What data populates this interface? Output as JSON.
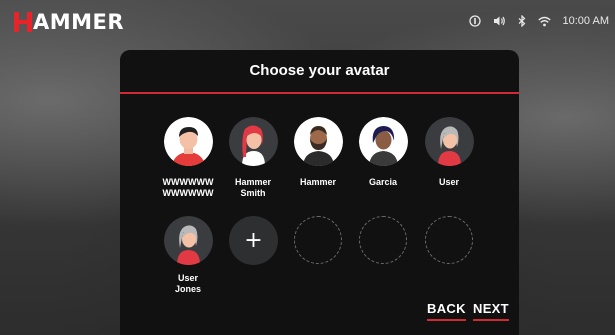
{
  "brand": {
    "logo_text": "AMMER",
    "accent": "#d22a33"
  },
  "status_bar": {
    "icons": [
      "info-badge-icon",
      "volume-icon",
      "bluetooth-icon",
      "wifi-icon"
    ],
    "time": "10:00 AM"
  },
  "dialog": {
    "title": "Choose your avatar",
    "avatars": [
      {
        "label": "WWWWWW\nWWWWWW",
        "icon": "avatar-man-short-hair-icon"
      },
      {
        "label": "Hammer\nSmith",
        "icon": "avatar-woman-red-hair-icon"
      },
      {
        "label": "Hammer",
        "icon": "avatar-man-beard-icon"
      },
      {
        "label": "Garcia",
        "icon": "avatar-woman-dark-hair-icon"
      },
      {
        "label": "User",
        "icon": "avatar-woman-gray-hair-icon"
      },
      {
        "label": "User\nJones",
        "icon": "avatar-woman-gray-hair-icon"
      }
    ],
    "add_label": "+",
    "back_label": "BACK",
    "next_label": "NEXT"
  }
}
